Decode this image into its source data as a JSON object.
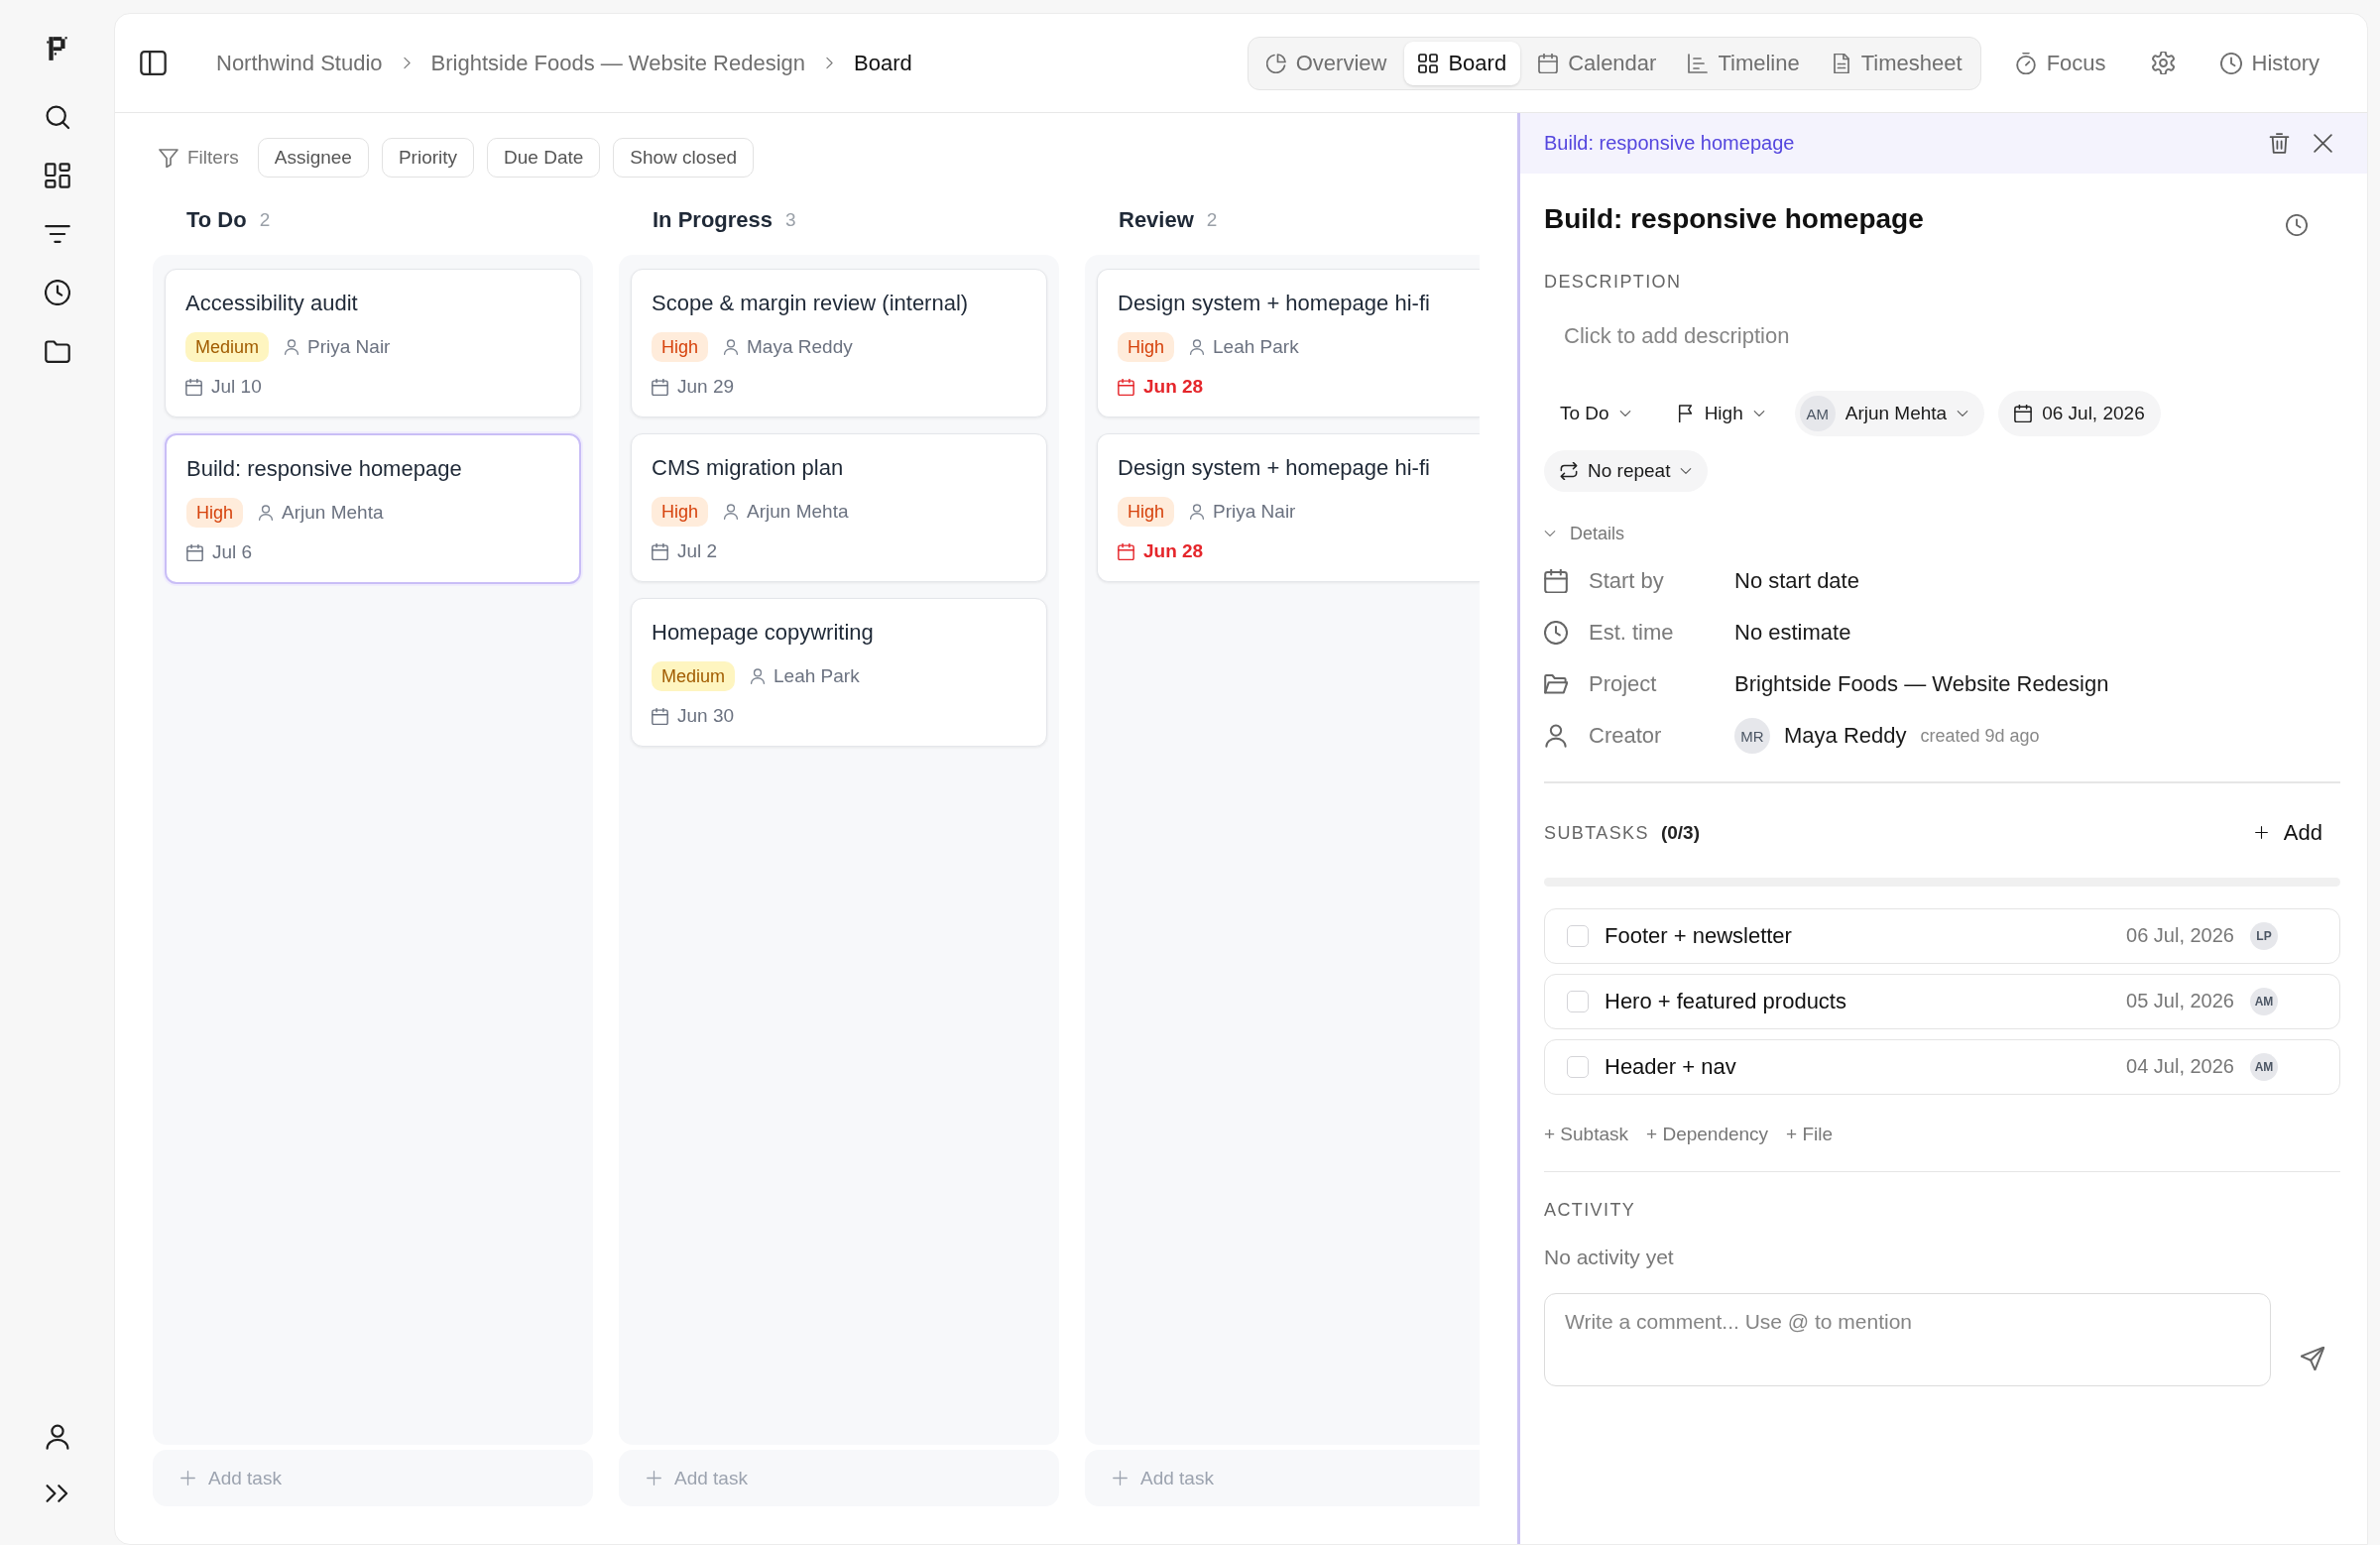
{
  "header": {
    "breadcrumbs": [
      {
        "label": "Northwind Studio",
        "current": false
      },
      {
        "label": "Brightside Foods — Website Redesign",
        "current": false
      },
      {
        "label": "Board",
        "current": true
      }
    ],
    "views": [
      {
        "label": "Overview",
        "selected": false
      },
      {
        "label": "Board",
        "selected": true
      },
      {
        "label": "Calendar",
        "selected": false
      },
      {
        "label": "Timeline",
        "selected": false
      },
      {
        "label": "Timesheet",
        "selected": false
      }
    ],
    "focus": "Focus",
    "history": "History"
  },
  "filters": {
    "label": "Filters",
    "chips": [
      "Assignee",
      "Priority",
      "Due Date",
      "Show closed"
    ]
  },
  "columns": [
    {
      "title": "To Do",
      "count": "2",
      "cards": [
        {
          "title": "Accessibility audit",
          "priority": {
            "kind": "medium",
            "label": "Medium"
          },
          "assignee": "Priya Nair",
          "due": "Jul 10",
          "overdue": false,
          "selected": false
        },
        {
          "title": "Build: responsive homepage",
          "priority": {
            "kind": "high",
            "label": "High"
          },
          "assignee": "Arjun Mehta",
          "due": "Jul 6",
          "overdue": false,
          "selected": true
        }
      ],
      "add_label": "Add task"
    },
    {
      "title": "In Progress",
      "count": "3",
      "cards": [
        {
          "title": "Scope & margin review (internal)",
          "priority": {
            "kind": "high",
            "label": "High"
          },
          "assignee": "Maya Reddy",
          "due": "Jun 29",
          "overdue": false,
          "selected": false
        },
        {
          "title": "CMS migration plan",
          "priority": {
            "kind": "high",
            "label": "High"
          },
          "assignee": "Arjun Mehta",
          "due": "Jul 2",
          "overdue": false,
          "selected": false
        },
        {
          "title": "Homepage copywriting",
          "priority": {
            "kind": "medium",
            "label": "Medium"
          },
          "assignee": "Leah Park",
          "due": "Jun 30",
          "overdue": false,
          "selected": false
        }
      ],
      "add_label": "Add task"
    },
    {
      "title": "Review",
      "count": "2",
      "cards": [
        {
          "title": "Design system + homepage hi-fi",
          "priority": {
            "kind": "high",
            "label": "High"
          },
          "assignee": "Leah Park",
          "due": "Jun 28",
          "overdue": true,
          "selected": false
        },
        {
          "title": "Design system + homepage hi-fi",
          "priority": {
            "kind": "high",
            "label": "High"
          },
          "assignee": "Priya Nair",
          "due": "Jun 28",
          "overdue": true,
          "selected": false
        }
      ],
      "add_label": "Add task"
    }
  ],
  "task_panel": {
    "breadcrumb": "Build: responsive homepage",
    "title": "Build: responsive homepage",
    "description": {
      "label": "DESCRIPTION",
      "placeholder": "Click to add description"
    },
    "properties": [
      {
        "kind": "status",
        "label": "To Do"
      },
      {
        "kind": "priority",
        "label": "High"
      },
      {
        "kind": "assignee",
        "initials": "AM",
        "label": "Arjun Mehta"
      },
      {
        "kind": "date",
        "label": "06 Jul, 2026"
      }
    ],
    "repeat": "No repeat",
    "details": {
      "label": "Details",
      "expanded": true,
      "rows": [
        {
          "kind": "text",
          "label": "Start by",
          "value": "No start date"
        },
        {
          "kind": "text",
          "label": "Est. time",
          "value": "No estimate"
        },
        {
          "kind": "text",
          "label": "Project",
          "value": "Brightside Foods — Website Redesign"
        },
        {
          "kind": "person",
          "label": "Creator",
          "initials": "MR",
          "value": "Maya Reddy",
          "note": "created 9d ago"
        }
      ]
    },
    "subtasks": {
      "label": "SUBTASKS",
      "count": "(0/3)",
      "add": "Add",
      "items": [
        {
          "title": "Footer + newsletter",
          "date": "06 Jul, 2026",
          "initials": "LP",
          "checked": false
        },
        {
          "title": "Hero + featured products",
          "date": "05 Jul, 2026",
          "initials": "AM",
          "checked": false
        },
        {
          "title": "Header + nav",
          "date": "04 Jul, 2026",
          "initials": "AM",
          "checked": false
        }
      ],
      "links": [
        "+ Subtask",
        "+ Dependency",
        "+ File"
      ]
    },
    "activity": {
      "label": "ACTIVITY",
      "empty": "No activity yet",
      "comment": {
        "placeholder": "Write a comment... Use @ to mention"
      }
    }
  }
}
